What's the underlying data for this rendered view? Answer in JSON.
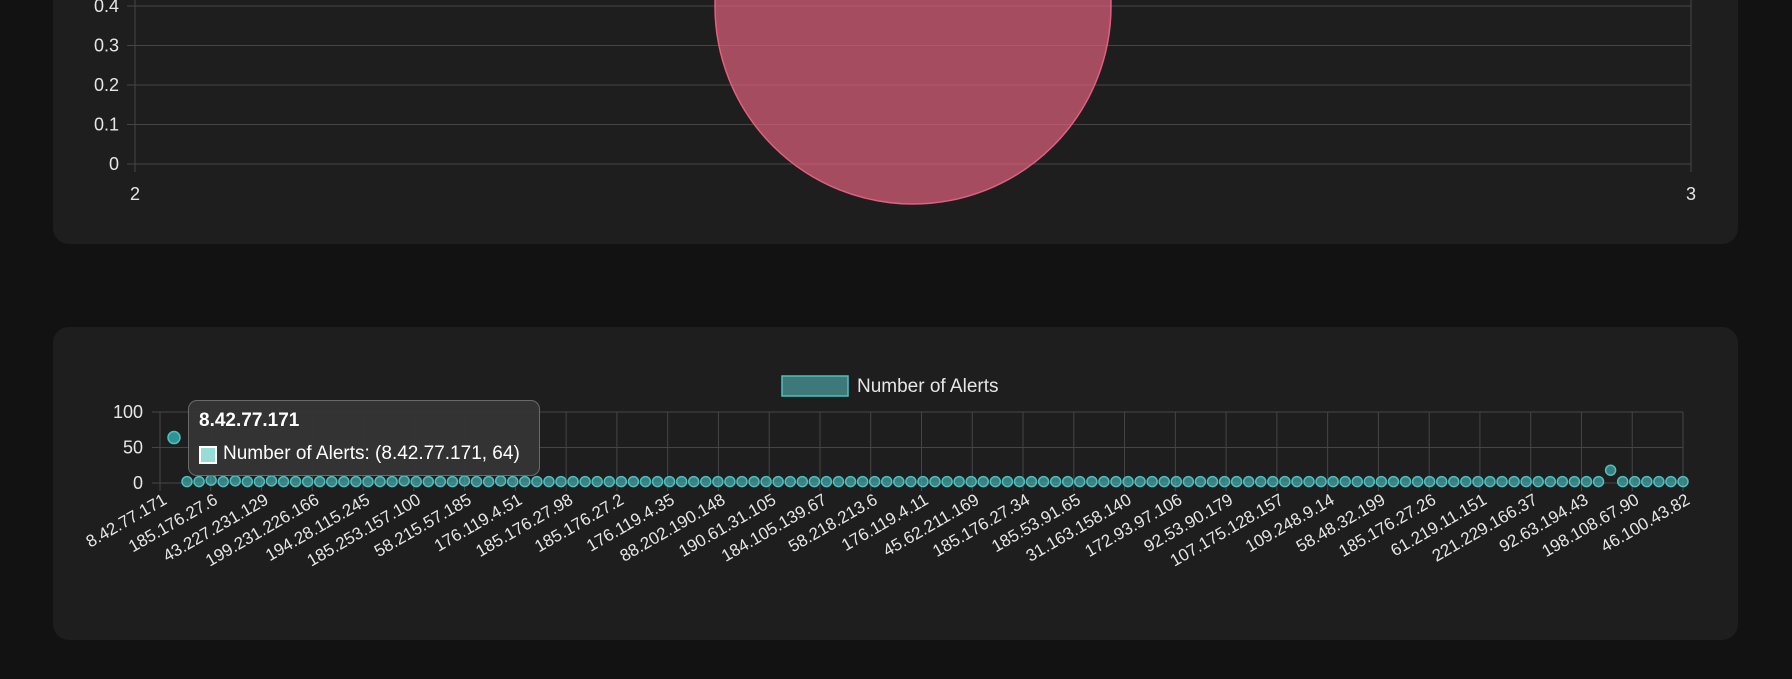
{
  "chart_data": [
    {
      "type": "bubble",
      "x_ticks": [
        "2",
        "3"
      ],
      "y_ticks": [
        "0",
        "0.1",
        "0.2",
        "0.3",
        "0.4"
      ],
      "xlim": [
        2,
        3
      ],
      "ylim": [
        0,
        0.4
      ],
      "series": [
        {
          "points": [
            {
              "x": 2.5,
              "y": 0.4
            }
          ],
          "color": "#e0607e"
        }
      ]
    },
    {
      "type": "scatter",
      "legend": {
        "label": "Number of Alerts",
        "position": "top"
      },
      "ylim": [
        0,
        100
      ],
      "y_ticks": [
        "0",
        "50",
        "100"
      ],
      "x_tick_labels": [
        "8.42.77.171",
        "185.176.27.6",
        "43.227.231.129",
        "199.231.226.166",
        "194.28.115.245",
        "185.253.157.100",
        "58.215.57.185",
        "176.119.4.51",
        "185.176.27.98",
        "185.176.27.2",
        "176.119.4.35",
        "88.202.190.148",
        "190.61.31.105",
        "184.105.139.67",
        "58.218.213.6",
        "176.119.4.11",
        "45.62.211.169",
        "185.176.27.34",
        "185.53.91.65",
        "31.163.158.140",
        "172.93.97.106",
        "92.53.90.179",
        "107.175.128.157",
        "109.248.9.14",
        "58.48.32.199",
        "185.176.27.26",
        "61.219.11.151",
        "221.229.166.37",
        "92.63.194.43",
        "198.108.67.90",
        "46.100.43.82"
      ],
      "values": [
        64,
        2,
        2,
        4,
        2,
        3,
        2,
        2,
        3,
        2,
        2,
        2,
        2,
        2,
        2,
        2,
        2,
        2,
        2,
        3,
        2,
        2,
        2,
        2,
        3,
        2,
        2,
        3,
        2,
        2,
        2,
        2,
        2,
        2,
        2,
        2,
        2,
        2,
        2,
        2,
        2,
        2,
        2,
        2,
        2,
        2,
        2,
        2,
        2,
        2,
        2,
        2,
        2,
        2,
        2,
        2,
        2,
        2,
        2,
        2,
        2,
        2,
        2,
        2,
        2,
        2,
        2,
        2,
        2,
        2,
        2,
        2,
        2,
        2,
        2,
        2,
        2,
        2,
        2,
        2,
        2,
        2,
        2,
        2,
        2,
        2,
        2,
        2,
        2,
        2,
        2,
        2,
        2,
        2,
        2,
        2,
        2,
        2,
        2,
        2,
        2,
        2,
        2,
        2,
        2,
        2,
        2,
        2,
        2,
        2,
        2,
        2,
        2,
        2,
        2,
        2,
        2,
        2,
        2,
        18,
        2,
        2,
        2,
        2,
        2,
        2
      ],
      "point_color": "#4bc0c0",
      "tooltip": {
        "title": "8.42.77.171",
        "body": "Number of Alerts: (8.42.77.171, 64)"
      }
    }
  ]
}
